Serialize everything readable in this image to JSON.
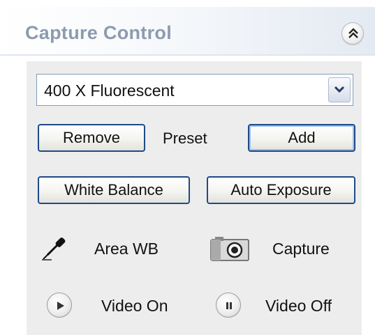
{
  "panel": {
    "title": "Capture Control"
  },
  "preset": {
    "selected": "400 X Fluorescent",
    "label": "Preset",
    "remove_label": "Remove",
    "add_label": "Add"
  },
  "adjust": {
    "white_balance_label": "White Balance",
    "auto_exposure_label": "Auto Exposure"
  },
  "tools": {
    "area_wb_label": "Area WB",
    "capture_label": "Capture",
    "video_on_label": "Video On",
    "video_off_label": "Video Off"
  },
  "icons": {
    "collapse": "chevron-double-up-icon",
    "dropdown": "chevron-down-icon",
    "area_wb": "eyedropper-icon",
    "capture": "camera-icon",
    "video_on": "play-icon",
    "video_off": "pause-icon"
  },
  "colors": {
    "title_text": "#8d9bb0",
    "button_border": "#1f4a87",
    "body_background": "#ededed"
  }
}
